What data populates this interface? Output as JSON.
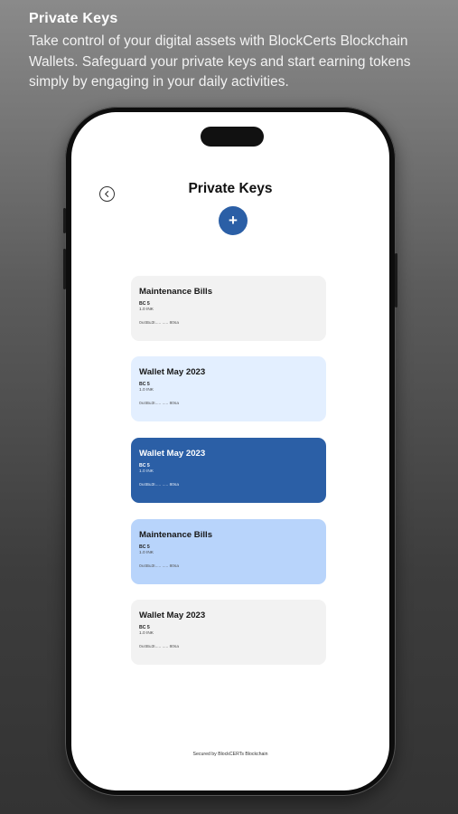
{
  "promo": {
    "title": "Private Keys",
    "description": "Take control of your digital assets with BlockCerts Blockchain Wallets. Safeguard your private keys and start earning tokens simply by engaging in your daily activities."
  },
  "screen": {
    "title": "Private Keys",
    "back_icon": "back-circle-icon",
    "add_label": "+",
    "footer": "Secured by BlockCERTs Blockchain"
  },
  "colors": {
    "accent": "#2b5fa6",
    "card_gray": "#f2f2f2",
    "card_light_blue": "#e3efff",
    "card_medium_blue": "#b8d4fb"
  },
  "wallets": [
    {
      "name": "Maintenance Bills",
      "currency": "BC 5",
      "balance": "1.0 INK",
      "address": "0x4Bu3I..... ..... 80sa",
      "style": "gray"
    },
    {
      "name": "Wallet May 2023",
      "currency": "BC 5",
      "balance": "1.0 INK",
      "address": "0x4Bu3I..... ..... 80sa",
      "style": "light-blue"
    },
    {
      "name": "Wallet May 2023",
      "currency": "BC 5",
      "balance": "1.0 INK",
      "address": "0x4Bu3I..... ..... 80sa",
      "style": "dark-blue"
    },
    {
      "name": "Maintenance Bills",
      "currency": "BC 5",
      "balance": "1.0 INK",
      "address": "0x4Bu3I..... ..... 80sa",
      "style": "medium-blue"
    },
    {
      "name": "Wallet May 2023",
      "currency": "BC 5",
      "balance": "1.0 INK",
      "address": "0x4Bu3I..... ..... 80sa",
      "style": "gray"
    }
  ]
}
